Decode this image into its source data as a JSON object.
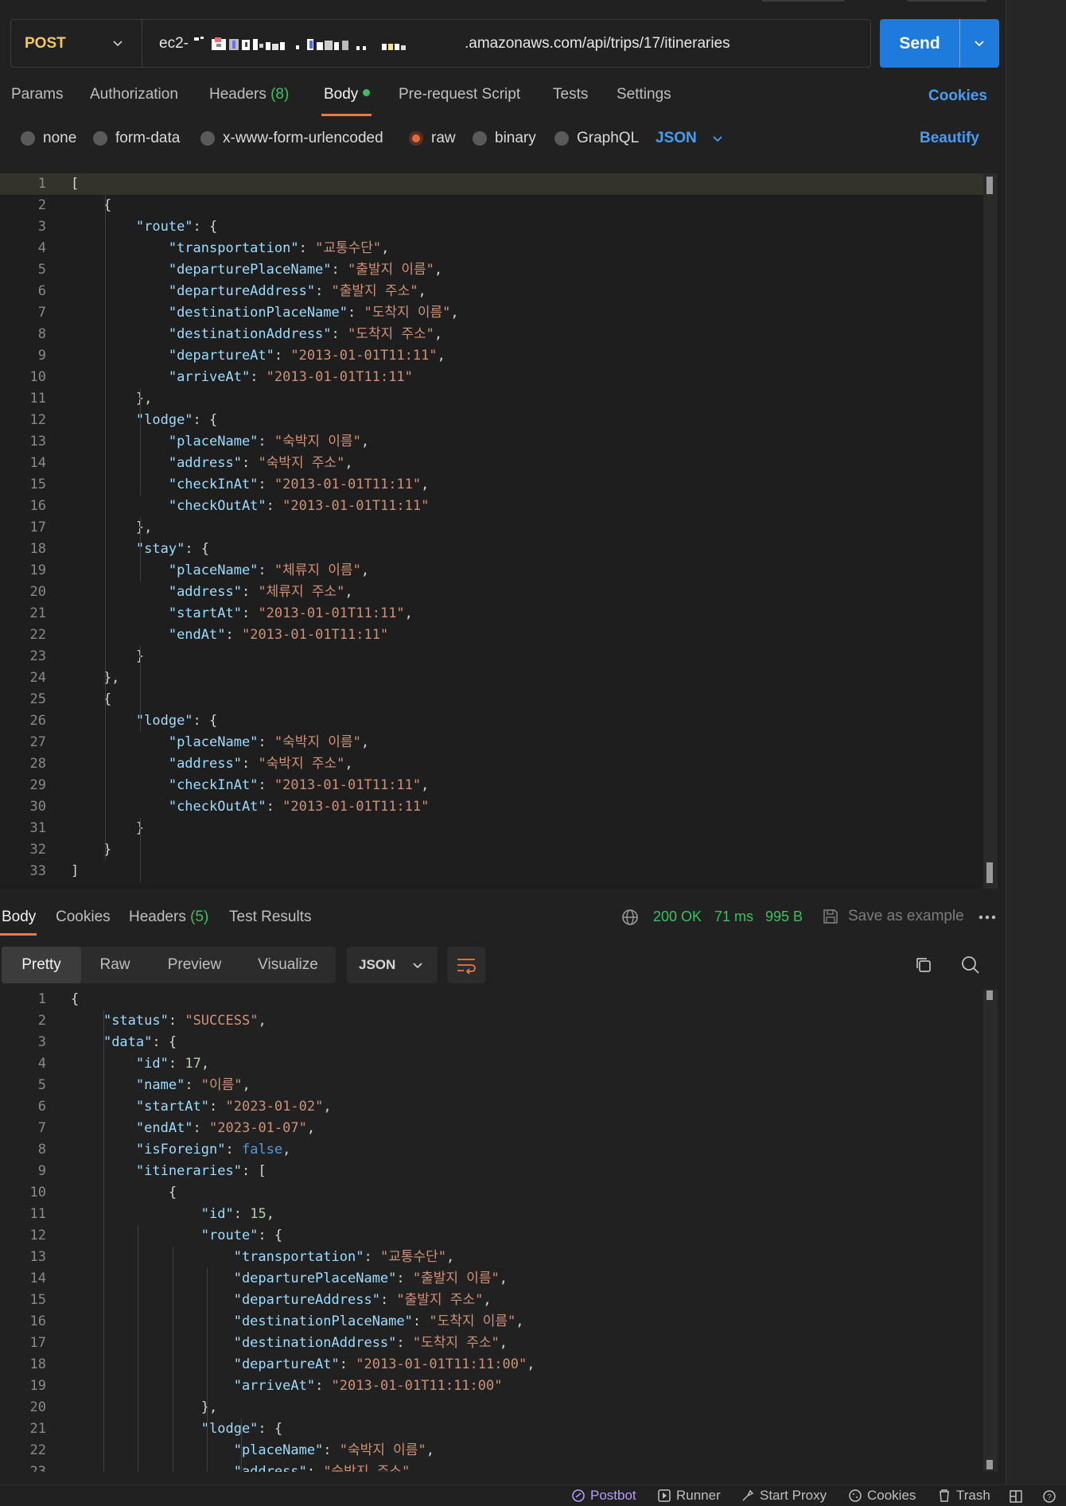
{
  "request": {
    "method": "POST",
    "url_prefix": "ec2-",
    "url_suffix": ".amazonaws.com/api/trips/17/itineraries",
    "send_label": "Send"
  },
  "req_tabs": [
    {
      "label": "Params"
    },
    {
      "label": "Authorization"
    },
    {
      "label": "Headers",
      "count": "(8)"
    },
    {
      "label": "Body"
    },
    {
      "label": "Pre-request Script"
    },
    {
      "label": "Tests"
    },
    {
      "label": "Settings"
    }
  ],
  "cookies_label": "Cookies",
  "body_types": [
    "none",
    "form-data",
    "x-www-form-urlencoded",
    "raw",
    "binary",
    "GraphQL"
  ],
  "body_selected": "raw",
  "body_format": "JSON",
  "beautify_label": "Beautify",
  "request_body": [
    [
      [
        "p",
        "["
      ]
    ],
    [
      [
        "p",
        "    {"
      ]
    ],
    [
      [
        "p",
        "        "
      ],
      [
        "k",
        "\"route\""
      ],
      [
        "p",
        ": {"
      ]
    ],
    [
      [
        "p",
        "            "
      ],
      [
        "k",
        "\"transportation\""
      ],
      [
        "p",
        ": "
      ],
      [
        "s",
        "\"교통수단\""
      ],
      [
        "p",
        ","
      ]
    ],
    [
      [
        "p",
        "            "
      ],
      [
        "k",
        "\"departurePlaceName\""
      ],
      [
        "p",
        ": "
      ],
      [
        "s",
        "\"출발지 이름\""
      ],
      [
        "p",
        ","
      ]
    ],
    [
      [
        "p",
        "            "
      ],
      [
        "k",
        "\"departureAddress\""
      ],
      [
        "p",
        ": "
      ],
      [
        "s",
        "\"출발지 주소\""
      ],
      [
        "p",
        ","
      ]
    ],
    [
      [
        "p",
        "            "
      ],
      [
        "k",
        "\"destinationPlaceName\""
      ],
      [
        "p",
        ": "
      ],
      [
        "s",
        "\"도착지 이름\""
      ],
      [
        "p",
        ","
      ]
    ],
    [
      [
        "p",
        "            "
      ],
      [
        "k",
        "\"destinationAddress\""
      ],
      [
        "p",
        ": "
      ],
      [
        "s",
        "\"도착지 주소\""
      ],
      [
        "p",
        ","
      ]
    ],
    [
      [
        "p",
        "            "
      ],
      [
        "k",
        "\"departureAt\""
      ],
      [
        "p",
        ": "
      ],
      [
        "s",
        "\"2013-01-01T11:11\""
      ],
      [
        "p",
        ","
      ]
    ],
    [
      [
        "p",
        "            "
      ],
      [
        "k",
        "\"arriveAt\""
      ],
      [
        "p",
        ": "
      ],
      [
        "s",
        "\"2013-01-01T11:11\""
      ]
    ],
    [
      [
        "p",
        "        },"
      ]
    ],
    [
      [
        "p",
        "        "
      ],
      [
        "k",
        "\"lodge\""
      ],
      [
        "p",
        ": {"
      ]
    ],
    [
      [
        "p",
        "            "
      ],
      [
        "k",
        "\"placeName\""
      ],
      [
        "p",
        ": "
      ],
      [
        "s",
        "\"숙박지 이름\""
      ],
      [
        "p",
        ","
      ]
    ],
    [
      [
        "p",
        "            "
      ],
      [
        "k",
        "\"address\""
      ],
      [
        "p",
        ": "
      ],
      [
        "s",
        "\"숙박지 주소\""
      ],
      [
        "p",
        ","
      ]
    ],
    [
      [
        "p",
        "            "
      ],
      [
        "k",
        "\"checkInAt\""
      ],
      [
        "p",
        ": "
      ],
      [
        "s",
        "\"2013-01-01T11:11\""
      ],
      [
        "p",
        ","
      ]
    ],
    [
      [
        "p",
        "            "
      ],
      [
        "k",
        "\"checkOutAt\""
      ],
      [
        "p",
        ": "
      ],
      [
        "s",
        "\"2013-01-01T11:11\""
      ]
    ],
    [
      [
        "p",
        "        },"
      ]
    ],
    [
      [
        "p",
        "        "
      ],
      [
        "k",
        "\"stay\""
      ],
      [
        "p",
        ": {"
      ]
    ],
    [
      [
        "p",
        "            "
      ],
      [
        "k",
        "\"placeName\""
      ],
      [
        "p",
        ": "
      ],
      [
        "s",
        "\"체류지 이름\""
      ],
      [
        "p",
        ","
      ]
    ],
    [
      [
        "p",
        "            "
      ],
      [
        "k",
        "\"address\""
      ],
      [
        "p",
        ": "
      ],
      [
        "s",
        "\"체류지 주소\""
      ],
      [
        "p",
        ","
      ]
    ],
    [
      [
        "p",
        "            "
      ],
      [
        "k",
        "\"startAt\""
      ],
      [
        "p",
        ": "
      ],
      [
        "s",
        "\"2013-01-01T11:11\""
      ],
      [
        "p",
        ","
      ]
    ],
    [
      [
        "p",
        "            "
      ],
      [
        "k",
        "\"endAt\""
      ],
      [
        "p",
        ": "
      ],
      [
        "s",
        "\"2013-01-01T11:11\""
      ]
    ],
    [
      [
        "p",
        "        }"
      ]
    ],
    [
      [
        "p",
        "    },"
      ]
    ],
    [
      [
        "p",
        "    {"
      ]
    ],
    [
      [
        "p",
        "        "
      ],
      [
        "k",
        "\"lodge\""
      ],
      [
        "p",
        ": {"
      ]
    ],
    [
      [
        "p",
        "            "
      ],
      [
        "k",
        "\"placeName\""
      ],
      [
        "p",
        ": "
      ],
      [
        "s",
        "\"숙박지 이름\""
      ],
      [
        "p",
        ","
      ]
    ],
    [
      [
        "p",
        "            "
      ],
      [
        "k",
        "\"address\""
      ],
      [
        "p",
        ": "
      ],
      [
        "s",
        "\"숙박지 주소\""
      ],
      [
        "p",
        ","
      ]
    ],
    [
      [
        "p",
        "            "
      ],
      [
        "k",
        "\"checkInAt\""
      ],
      [
        "p",
        ": "
      ],
      [
        "s",
        "\"2013-01-01T11:11\""
      ],
      [
        "p",
        ","
      ]
    ],
    [
      [
        "p",
        "            "
      ],
      [
        "k",
        "\"checkOutAt\""
      ],
      [
        "p",
        ": "
      ],
      [
        "s",
        "\"2013-01-01T11:11\""
      ]
    ],
    [
      [
        "p",
        "        }"
      ]
    ],
    [
      [
        "p",
        "    }"
      ]
    ],
    [
      [
        "p",
        "]"
      ]
    ]
  ],
  "resp_tabs": [
    {
      "label": "Body"
    },
    {
      "label": "Cookies"
    },
    {
      "label": "Headers",
      "count": "(5)"
    },
    {
      "label": "Test Results"
    }
  ],
  "response_status": {
    "code": "200 OK",
    "time": "71 ms",
    "size": "995 B"
  },
  "save_example_label": "Save as example",
  "view_modes": [
    "Pretty",
    "Raw",
    "Preview",
    "Visualize"
  ],
  "view_selected": "Pretty",
  "response_format": "JSON",
  "response_body": [
    [
      [
        "p",
        "{"
      ]
    ],
    [
      [
        "p",
        "    "
      ],
      [
        "k",
        "\"status\""
      ],
      [
        "p",
        ": "
      ],
      [
        "s",
        "\"SUCCESS\""
      ],
      [
        "p",
        ","
      ]
    ],
    [
      [
        "p",
        "    "
      ],
      [
        "k",
        "\"data\""
      ],
      [
        "p",
        ": {"
      ]
    ],
    [
      [
        "p",
        "        "
      ],
      [
        "k",
        "\"id\""
      ],
      [
        "p",
        ": "
      ],
      [
        "n",
        "17"
      ],
      [
        "p",
        ","
      ]
    ],
    [
      [
        "p",
        "        "
      ],
      [
        "k",
        "\"name\""
      ],
      [
        "p",
        ": "
      ],
      [
        "s",
        "\"이름\""
      ],
      [
        "p",
        ","
      ]
    ],
    [
      [
        "p",
        "        "
      ],
      [
        "k",
        "\"startAt\""
      ],
      [
        "p",
        ": "
      ],
      [
        "s",
        "\"2023-01-02\""
      ],
      [
        "p",
        ","
      ]
    ],
    [
      [
        "p",
        "        "
      ],
      [
        "k",
        "\"endAt\""
      ],
      [
        "p",
        ": "
      ],
      [
        "s",
        "\"2023-01-07\""
      ],
      [
        "p",
        ","
      ]
    ],
    [
      [
        "p",
        "        "
      ],
      [
        "k",
        "\"isForeign\""
      ],
      [
        "p",
        ": "
      ],
      [
        "b",
        "false"
      ],
      [
        "p",
        ","
      ]
    ],
    [
      [
        "p",
        "        "
      ],
      [
        "k",
        "\"itineraries\""
      ],
      [
        "p",
        ": ["
      ]
    ],
    [
      [
        "p",
        "            {"
      ]
    ],
    [
      [
        "p",
        "                "
      ],
      [
        "k",
        "\"id\""
      ],
      [
        "p",
        ": "
      ],
      [
        "n",
        "15"
      ],
      [
        "p",
        ","
      ]
    ],
    [
      [
        "p",
        "                "
      ],
      [
        "k",
        "\"route\""
      ],
      [
        "p",
        ": {"
      ]
    ],
    [
      [
        "p",
        "                    "
      ],
      [
        "k",
        "\"transportation\""
      ],
      [
        "p",
        ": "
      ],
      [
        "s",
        "\"교통수단\""
      ],
      [
        "p",
        ","
      ]
    ],
    [
      [
        "p",
        "                    "
      ],
      [
        "k",
        "\"departurePlaceName\""
      ],
      [
        "p",
        ": "
      ],
      [
        "s",
        "\"출발지 이름\""
      ],
      [
        "p",
        ","
      ]
    ],
    [
      [
        "p",
        "                    "
      ],
      [
        "k",
        "\"departureAddress\""
      ],
      [
        "p",
        ": "
      ],
      [
        "s",
        "\"출발지 주소\""
      ],
      [
        "p",
        ","
      ]
    ],
    [
      [
        "p",
        "                    "
      ],
      [
        "k",
        "\"destinationPlaceName\""
      ],
      [
        "p",
        ": "
      ],
      [
        "s",
        "\"도착지 이름\""
      ],
      [
        "p",
        ","
      ]
    ],
    [
      [
        "p",
        "                    "
      ],
      [
        "k",
        "\"destinationAddress\""
      ],
      [
        "p",
        ": "
      ],
      [
        "s",
        "\"도착지 주소\""
      ],
      [
        "p",
        ","
      ]
    ],
    [
      [
        "p",
        "                    "
      ],
      [
        "k",
        "\"departureAt\""
      ],
      [
        "p",
        ": "
      ],
      [
        "s",
        "\"2013-01-01T11:11:00\""
      ],
      [
        "p",
        ","
      ]
    ],
    [
      [
        "p",
        "                    "
      ],
      [
        "k",
        "\"arriveAt\""
      ],
      [
        "p",
        ": "
      ],
      [
        "s",
        "\"2013-01-01T11:11:00\""
      ]
    ],
    [
      [
        "p",
        "                },"
      ]
    ],
    [
      [
        "p",
        "                "
      ],
      [
        "k",
        "\"lodge\""
      ],
      [
        "p",
        ": {"
      ]
    ],
    [
      [
        "p",
        "                    "
      ],
      [
        "k",
        "\"placeName\""
      ],
      [
        "p",
        ": "
      ],
      [
        "s",
        "\"숙박지 이름\""
      ],
      [
        "p",
        ","
      ]
    ],
    [
      [
        "p",
        "                    "
      ],
      [
        "k",
        "\"address\""
      ],
      [
        "p",
        ": "
      ],
      [
        "s",
        "\"숙박지 주소\""
      ]
    ]
  ],
  "footer": [
    "Postbot",
    "Runner",
    "Start Proxy",
    "Cookies",
    "Trash"
  ],
  "colors": {
    "accent": "#ee7a3b",
    "send": "#1f7bdb",
    "link": "#4a9cf0",
    "ok": "#3fbf5f",
    "method": "#f0c85e"
  }
}
